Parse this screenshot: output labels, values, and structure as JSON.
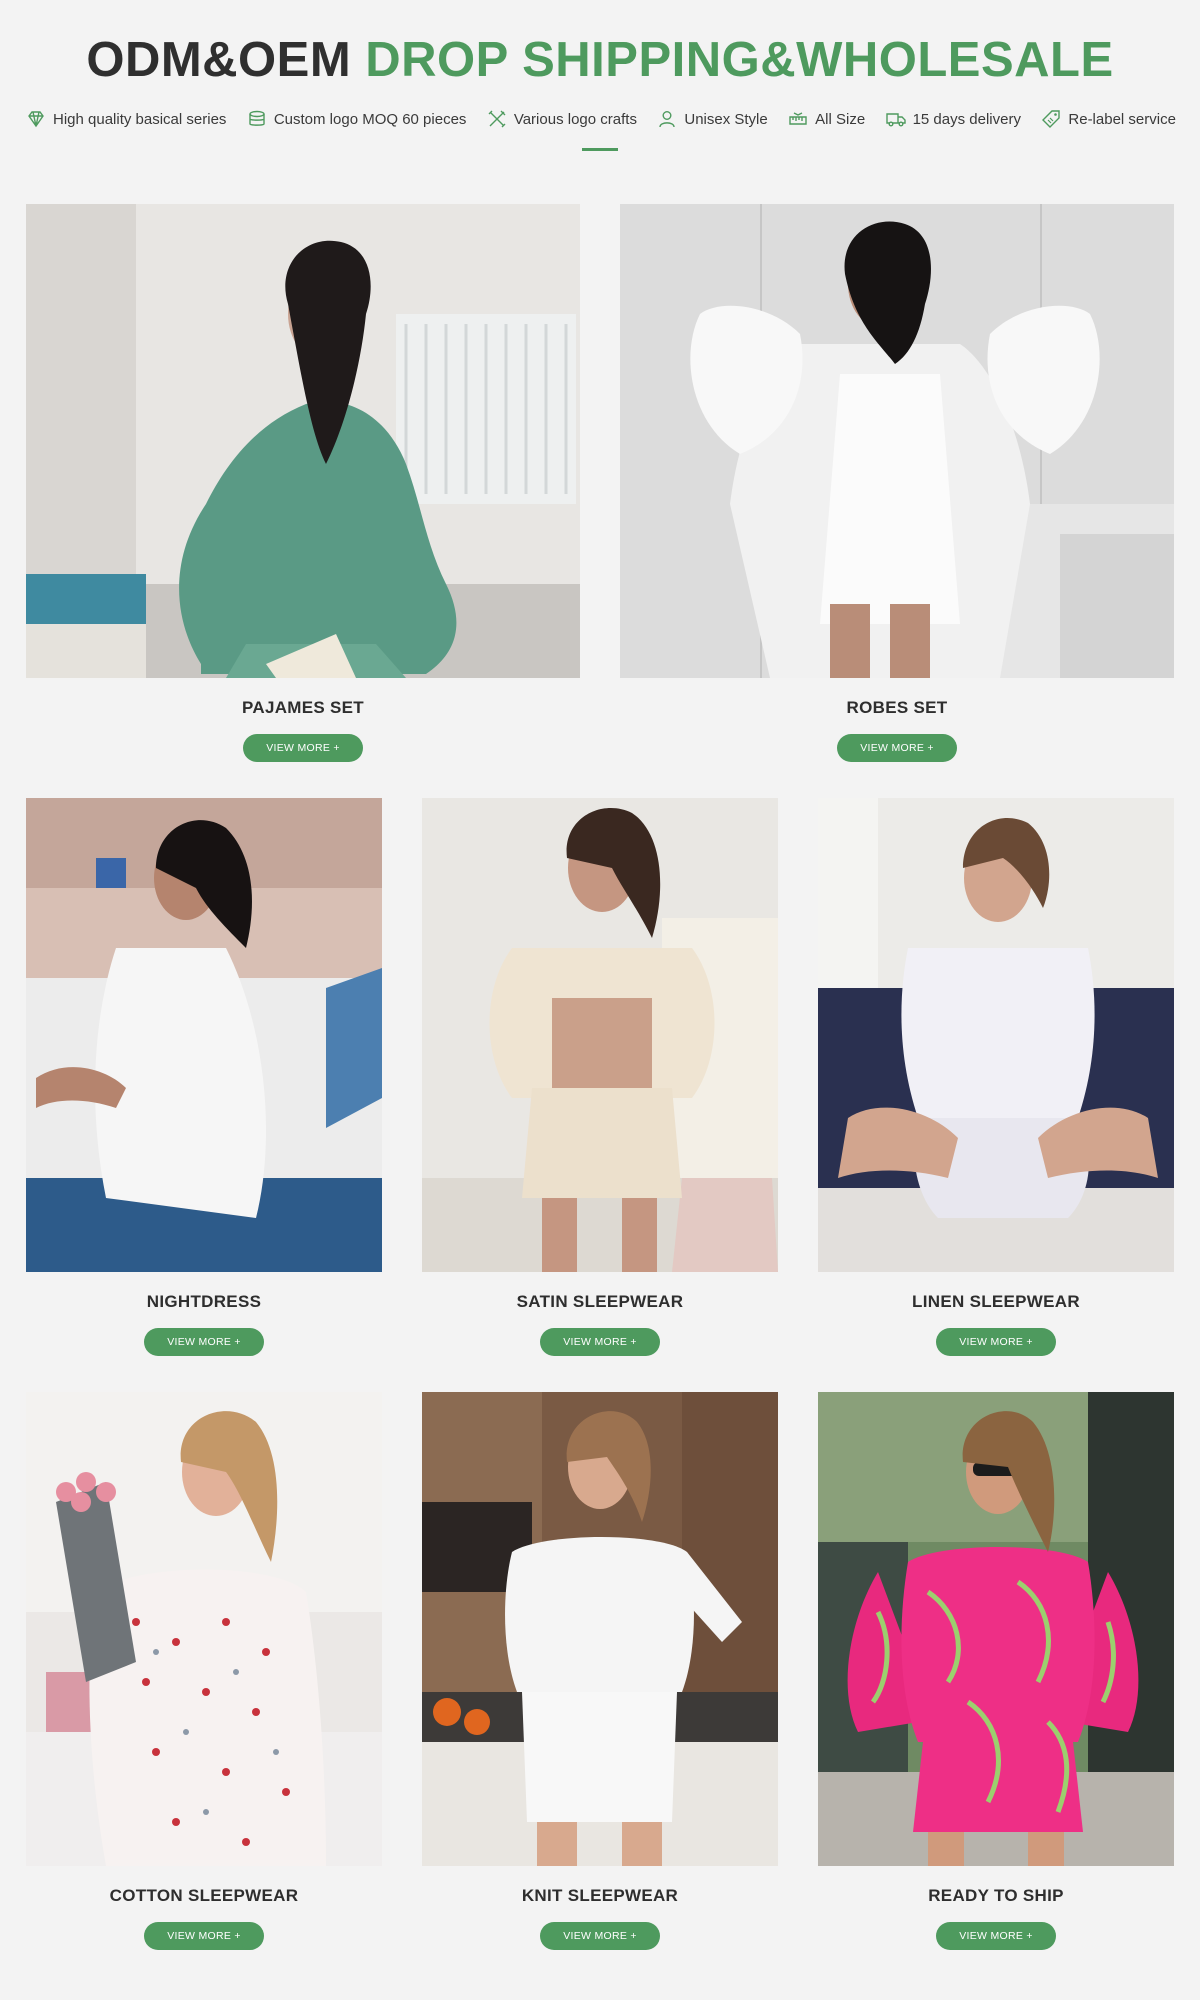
{
  "header": {
    "title_part1": "ODM&OEM",
    "title_part2": "DROP SHIPPING&WHOLESALE",
    "accent_color": "#4e9a5e"
  },
  "features": [
    {
      "icon": "diamond-icon",
      "label": "High quality basical series"
    },
    {
      "icon": "stack-icon",
      "label": "Custom logo MOQ 60 pieces"
    },
    {
      "icon": "tools-icon",
      "label": "Various logo crafts"
    },
    {
      "icon": "user-icon",
      "label": "Unisex Style"
    },
    {
      "icon": "ruler-icon",
      "label": "All Size"
    },
    {
      "icon": "truck-icon",
      "label": "15 days delivery"
    },
    {
      "icon": "tag-icon",
      "label": "Re-label service"
    }
  ],
  "categories": [
    {
      "name": "PAJAMES SET",
      "button": "VIEW MORE +",
      "image": "woman in green satin pajamas"
    },
    {
      "name": "ROBES SET",
      "button": "VIEW MORE +",
      "image": "woman in white feather robe"
    },
    {
      "name": "NIGHTDRESS",
      "button": "VIEW MORE +",
      "image": "woman in white nightdress"
    },
    {
      "name": "SATIN SLEEPWEAR",
      "button": "VIEW MORE +",
      "image": "woman in champagne satin set"
    },
    {
      "name": "LINEN SLEEPWEAR",
      "button": "VIEW MORE +",
      "image": "woman in white linen set"
    },
    {
      "name": "COTTON SLEEPWEAR",
      "button": "VIEW MORE +",
      "image": "woman in heart print pajamas"
    },
    {
      "name": "KNIT SLEEPWEAR",
      "button": "VIEW MORE +",
      "image": "woman in white knit set"
    },
    {
      "name": "READY TO SHIP",
      "button": "VIEW MORE +",
      "image": "woman in pink palm print set"
    }
  ]
}
